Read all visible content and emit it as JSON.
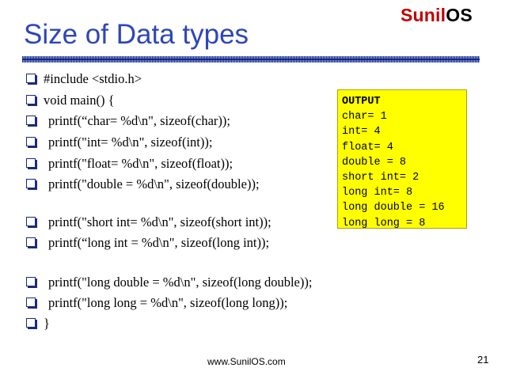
{
  "brand": {
    "part1": "Sunil",
    "part2": "OS"
  },
  "title": "Size of Data types",
  "code_lines": [
    "#include <stdio.h>",
    "void  main() {",
    "printf(“char= %d\\n\", sizeof(char));",
    "printf(\"int= %d\\n\", sizeof(int));",
    "printf(\"float= %d\\n\", sizeof(float));",
    "printf(\"double = %d\\n\", sizeof(double));",
    "printf(\"short int= %d\\n\", sizeof(short int));",
    "printf(“long int = %d\\n\", sizeof(long int));",
    "printf(\"long double = %d\\n\", sizeof(long double));",
    "printf(\"long long = %d\\n\", sizeof(long long));",
    "}"
  ],
  "output": {
    "heading": "OUTPUT",
    "lines": [
      "char= 1",
      "int= 4",
      "float= 4",
      "double = 8",
      "short int= 2",
      "long int= 8",
      "long double = 16",
      "long long = 8"
    ]
  },
  "footer": {
    "url": "www.SunilOS.com",
    "page_number": "21"
  },
  "colors": {
    "title": "#2e46b8",
    "brand_red": "#c00000",
    "output_bg": "#ffff00",
    "bullet": "#1a2a7a"
  }
}
